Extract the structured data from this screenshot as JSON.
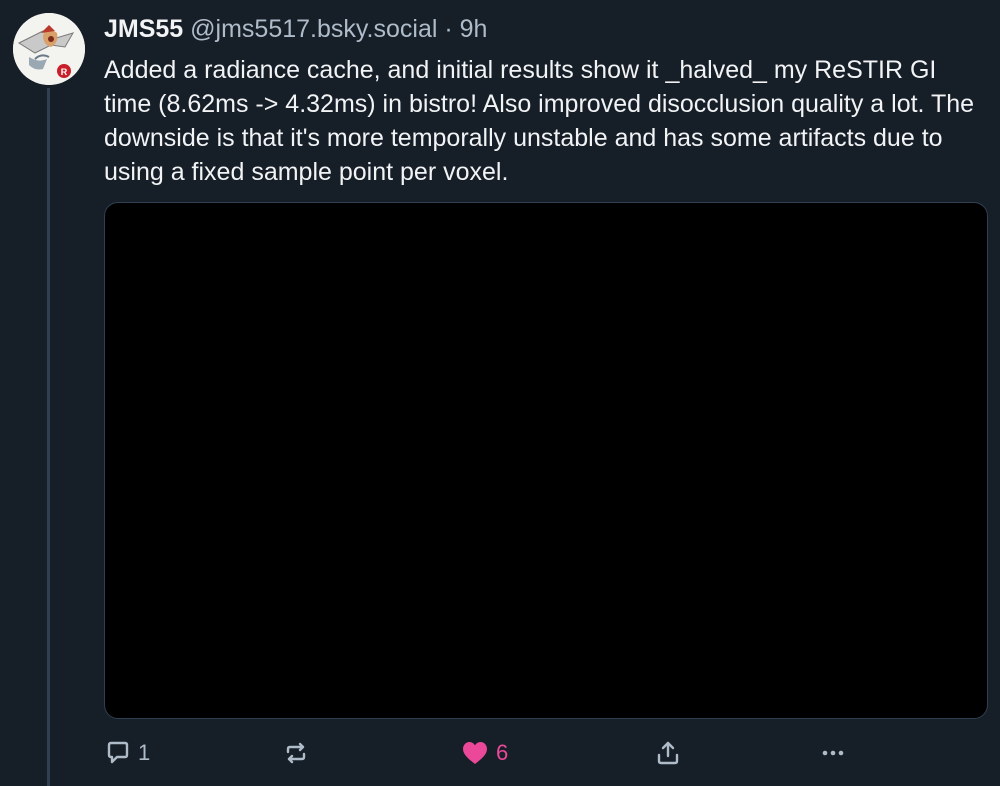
{
  "post": {
    "author": {
      "display_name": "JMS55",
      "handle": "@jms5517.bsky.social",
      "separator": "·",
      "time": "9h"
    },
    "text": "Added a radiance cache, and initial results show it _halved_ my ReSTIR GI time (8.62ms -> 4.32ms) in bistro! Also improved disocclusion quality a lot. The downside is that it's more temporally unstable and has some artifacts due to using a fixed sample point per voxel.",
    "media": {
      "kind": "video"
    },
    "actions": {
      "reply": {
        "icon": "reply-icon",
        "count": "1"
      },
      "repost": {
        "icon": "repost-icon",
        "count": ""
      },
      "like": {
        "icon": "heart-icon",
        "count": "6",
        "liked": true,
        "color": "#ec4899"
      },
      "share": {
        "icon": "share-icon"
      },
      "more": {
        "icon": "more-icon"
      }
    }
  },
  "colors": {
    "background": "#161e27",
    "text_primary": "#f1f3f5",
    "text_secondary": "#aebbc9",
    "thread_line": "#2e4052",
    "like_accent": "#ec4899"
  }
}
